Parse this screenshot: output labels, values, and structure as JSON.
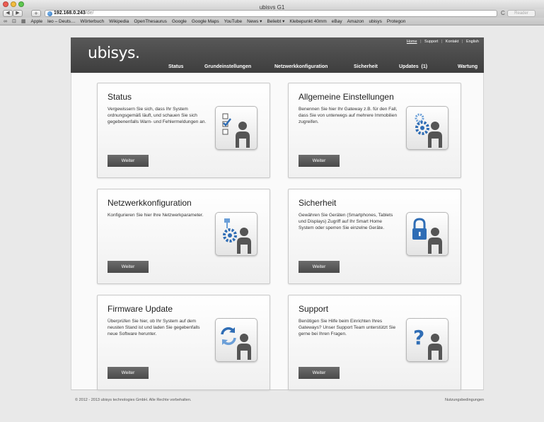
{
  "browser": {
    "title": "ubisys G1",
    "url_host": "192.168.0.243",
    "url_path": "/de/",
    "reader_label": "Reader",
    "back_glyph": "◀",
    "forward_glyph": "▶",
    "add_glyph": "+",
    "reload_glyph": "C",
    "bookmarks": [
      "Apple",
      "leo – Deuts…",
      "Wörterbuch",
      "Wikipedia",
      "OpenThesaurus",
      "Google",
      "Google Maps",
      "YouTube",
      "News ▾",
      "Beliebt ▾",
      "Klebepunkt 40mm",
      "eBay",
      "Amazon",
      "ubisys",
      "Protegon"
    ],
    "icons": [
      "reading-list-icon",
      "bookmarks-icon",
      "top-sites-icon",
      "globe-icon"
    ]
  },
  "site": {
    "logo": "ubisys.",
    "top_links": {
      "home": "Home",
      "support": "Support",
      "kontakt": "Kontakt",
      "english": "English",
      "separator": "|"
    },
    "nav": {
      "status": "Status",
      "grund": "Grundeinstellungen",
      "netz": "Netzwerkkonfiguration",
      "sicherheit": "Sicherheit",
      "updates": "Updates  (1)",
      "wartung": "Wartung"
    }
  },
  "cards": {
    "status": {
      "title": "Status",
      "text": "Vergewissern Sie sich, dass Ihr System ordnungsgemäß läuft, und schauen Sie sich gegebenenfalls Warn- und Fehlermeldungen an.",
      "button": "Weiter",
      "icon": "checklist-user-icon"
    },
    "allgemein": {
      "title": "Allgemeine Einstellungen",
      "text": "Benennen Sie hier Ihr Gateway z.B. für den Fall, dass Sie von unterwegs auf mehrere Immobilien zugreifen.",
      "button": "Weiter",
      "icon": "gears-user-icon"
    },
    "netzwerk": {
      "title": "Netzwerkkonfiguration",
      "text": "Konfigurieren Sie hier Ihre Netzwerkparameter.",
      "button": "Weiter",
      "icon": "network-gear-user-icon"
    },
    "sicherheit": {
      "title": "Sicherheit",
      "text": "Gewähren Sie Geräten (Smartphones, Tablets und Displays) Zugriff auf Ihr Smart Home System oder sperren Sie einzelne Geräte.",
      "button": "Weiter",
      "icon": "lock-user-icon"
    },
    "firmware": {
      "title": "Firmware Update",
      "text": "Überprüfen Sie hier, ob Ihr System auf dem neusten Stand ist und laden Sie gegebenfalls neue Software herunter.",
      "button": "Weiter",
      "icon": "refresh-user-icon"
    },
    "support": {
      "title": "Support",
      "text": "Benötigen Sie Hilfe beim Einrichten Ihres Gateways? Unser Support Team unterstützt Sie gerne bei Ihren Fragen.",
      "button": "Weiter",
      "icon": "question-user-icon"
    }
  },
  "footer": {
    "copyright": "© 2012 - 2013 ubisys technologies GmbH. Alle Rechte vorbehalten.",
    "terms": "Nutzungsbedingungen"
  },
  "colors": {
    "header_bg": "#4a4a4a",
    "button_bg": "#5a5a5a",
    "icon_blue": "#2f6db5",
    "user_gray": "#555555"
  }
}
